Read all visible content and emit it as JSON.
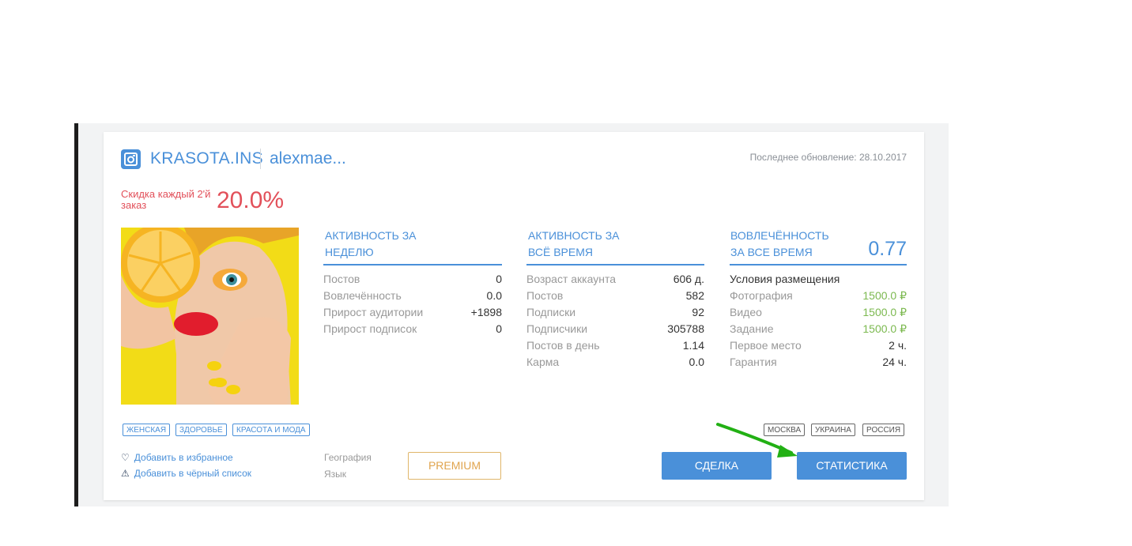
{
  "header": {
    "account_name": "KRASOTA.INS",
    "username": "alexmae...",
    "last_update": "Последнее обновление: 28.10.2017"
  },
  "discount": {
    "label": "Скидка каждый 2'й заказ",
    "value": "20.0%"
  },
  "weekly": {
    "title_line1": "АКТИВНОСТЬ ЗА",
    "title_line2": "НЕДЕЛЮ",
    "rows": [
      {
        "label": "Постов",
        "value": "0"
      },
      {
        "label": "Вовлечённость",
        "value": "0.0"
      },
      {
        "label": "Прирост аудитории",
        "value": "+1898"
      },
      {
        "label": "Прирост подписок",
        "value": "0"
      }
    ]
  },
  "alltime": {
    "title_line1": "АКТИВНОСТЬ ЗА",
    "title_line2": "ВСЁ ВРЕМЯ",
    "rows": [
      {
        "label": "Возраст аккаунта",
        "value": "606 д."
      },
      {
        "label": "Постов",
        "value": "582"
      },
      {
        "label": "Подписки",
        "value": "92"
      },
      {
        "label": "Подписчики",
        "value": "305788"
      },
      {
        "label": "Постов в день",
        "value": "1.14"
      },
      {
        "label": "Карма",
        "value": "0.0"
      }
    ]
  },
  "engagement": {
    "title_line1": "ВОВЛЕЧЁННОСТЬ",
    "title_line2": "ЗА ВСЕ ВРЕМЯ",
    "value": "0.77",
    "conditions_title": "Условия размещения",
    "rows": [
      {
        "label": "Фотография",
        "value": "1500.0 ₽"
      },
      {
        "label": "Видео",
        "value": "1500.0 ₽"
      },
      {
        "label": "Задание",
        "value": "1500.0 ₽"
      },
      {
        "label": "Первое место",
        "value": "2 ч."
      },
      {
        "label": "Гарантия",
        "value": "24 ч."
      }
    ]
  },
  "category_tags": [
    "ЖЕНСКАЯ",
    "ЗДОРОВЬЕ",
    "КРАСОТА И МОДА"
  ],
  "geo_tags": [
    "МОСКВА",
    "УКРАИНА",
    "РОССИЯ"
  ],
  "links": {
    "favorites": "Добавить в избранное",
    "blacklist": "Добавить в чёрный список"
  },
  "geo_info": {
    "geography": "География",
    "language": "Язык"
  },
  "buttons": {
    "premium": "PREMIUM",
    "deal": "СДЕЛКА",
    "stats": "СТАТИСТИКА"
  },
  "colors": {
    "accent": "#4a90d9",
    "discount": "#e2505a",
    "price": "#7cb950",
    "premium": "#e0a44e",
    "arrow": "#22b014"
  },
  "icons": [
    "instagram-icon",
    "heart-icon",
    "warning-icon"
  ]
}
